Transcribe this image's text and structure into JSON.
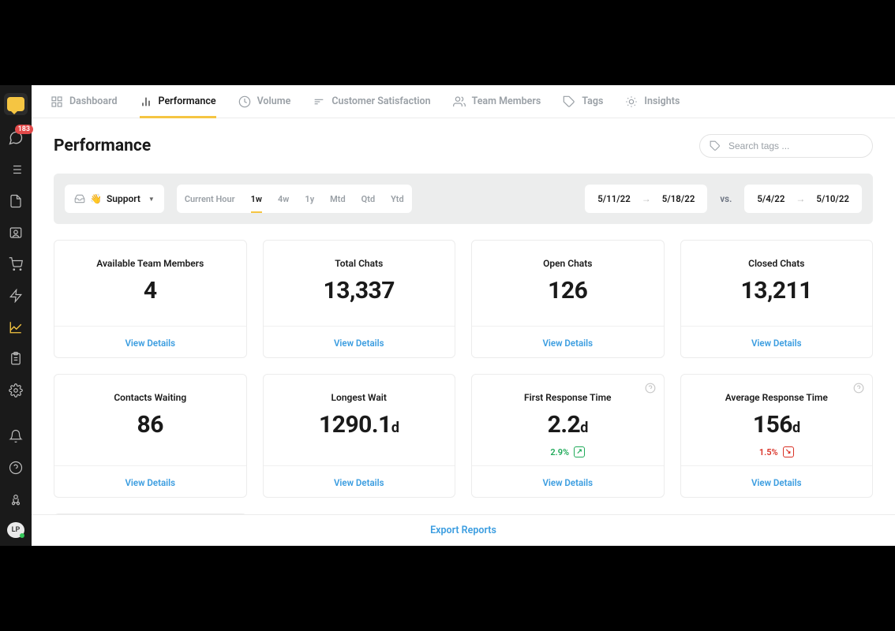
{
  "sidebar": {
    "badge": "183",
    "avatar_initials": "LP"
  },
  "tabs": [
    {
      "label": "Dashboard"
    },
    {
      "label": "Performance"
    },
    {
      "label": "Volume"
    },
    {
      "label": "Customer Satisfaction"
    },
    {
      "label": "Team Members"
    },
    {
      "label": "Tags"
    },
    {
      "label": "Insights"
    }
  ],
  "page_title": "Performance",
  "search": {
    "placeholder": "Search tags ..."
  },
  "channel": {
    "emoji": "👋",
    "label": "Support"
  },
  "ranges": [
    "Current Hour",
    "1w",
    "4w",
    "1y",
    "Mtd",
    "Qtd",
    "Ytd"
  ],
  "date_range_1": {
    "start": "5/11/22",
    "end": "5/18/22"
  },
  "vs_label": "vs.",
  "date_range_2": {
    "start": "5/4/22",
    "end": "5/10/22"
  },
  "cards": [
    {
      "title": "Available Team Members",
      "value": "4",
      "unit": "",
      "link": "View Details"
    },
    {
      "title": "Total Chats",
      "value": "13,337",
      "unit": "",
      "link": "View Details"
    },
    {
      "title": "Open Chats",
      "value": "126",
      "unit": "",
      "link": "View Details"
    },
    {
      "title": "Closed Chats",
      "value": "13,211",
      "unit": "",
      "link": "View Details"
    },
    {
      "title": "Contacts Waiting",
      "value": "86",
      "unit": "",
      "link": "View Details"
    },
    {
      "title": "Longest Wait",
      "value": "1290.1",
      "unit": "d",
      "link": "View Details"
    },
    {
      "title": "First Response Time",
      "value": "2.2",
      "unit": "d",
      "delta": "2.9%",
      "delta_dir": "up",
      "info": true,
      "link": "View Details"
    },
    {
      "title": "Average Response Time",
      "value": "156",
      "unit": "d",
      "delta": "1.5%",
      "delta_dir": "down",
      "info": true,
      "link": "View Details"
    }
  ],
  "export_label": "Export Reports"
}
